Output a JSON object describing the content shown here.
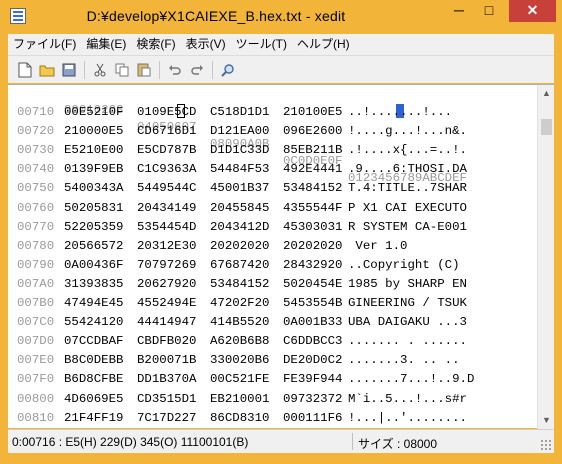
{
  "window": {
    "title": "D:¥develop¥X1CAIEXE_B.hex.txt - xedit",
    "minimize": "─",
    "maximize": "□",
    "close": "✕"
  },
  "menu": [
    "ファイル(F)",
    "編集(E)",
    "検索(F)",
    "表示(V)",
    "ツール(T)",
    "ヘルプ(H)"
  ],
  "toolbar": {
    "icons": [
      "new-file-icon",
      "open-folder-icon",
      "save-icon",
      "cut-icon",
      "copy-icon",
      "paste-icon",
      "undo-icon",
      "redo-icon",
      "search-icon"
    ]
  },
  "hex": {
    "header": {
      "groups": [
        "00010203",
        "04050607",
        "08090A0B",
        "0C0D0E0F"
      ],
      "ascii": "0123456789ABCDEF"
    },
    "rows": [
      {
        "offset": "00710",
        "groups": [
          "00E5210F",
          "0109E5CD",
          "C518D1D1",
          "210100E5"
        ],
        "ascii": "..!.......!..."
      },
      {
        "offset": "00720",
        "groups": [
          "210000E5",
          "CD6716D1",
          "D121EA00",
          "096E2600"
        ],
        "ascii": "!....g...!...n&."
      },
      {
        "offset": "00730",
        "groups": [
          "E5210E00",
          "E5CD787B",
          "D1D1C33D",
          "85EB211B"
        ],
        "ascii": ".!....x{...=..!."
      },
      {
        "offset": "00740",
        "groups": [
          "0139F9EB",
          "C1C9363A",
          "54484F53",
          "492E4441"
        ],
        "ascii": ".9....6:THOSI.DA"
      },
      {
        "offset": "00750",
        "groups": [
          "5400343A",
          "5449544C",
          "45001B37",
          "53484152"
        ],
        "ascii": "T.4:TITLE..7SHAR"
      },
      {
        "offset": "00760",
        "groups": [
          "50205831",
          "20434149",
          "20455845",
          "4355544F"
        ],
        "ascii": "P X1 CAI EXECUTO"
      },
      {
        "offset": "00770",
        "groups": [
          "52205359",
          "5354454D",
          "2043412D",
          "45303031"
        ],
        "ascii": "R SYSTEM CA-E001"
      },
      {
        "offset": "00780",
        "groups": [
          "20566572",
          "20312E30",
          "20202020",
          "20202020"
        ],
        "ascii": " Ver 1.0"
      },
      {
        "offset": "00790",
        "groups": [
          "0A00436F",
          "70797269",
          "67687420",
          "28432920"
        ],
        "ascii": "..Copyright (C)"
      },
      {
        "offset": "007A0",
        "groups": [
          "31393835",
          "20627920",
          "53484152",
          "5020454E"
        ],
        "ascii": "1985 by SHARP EN"
      },
      {
        "offset": "007B0",
        "groups": [
          "47494E45",
          "4552494E",
          "47202F20",
          "5453554B"
        ],
        "ascii": "GINEERING / TSUK"
      },
      {
        "offset": "007C0",
        "groups": [
          "55424120",
          "44414947",
          "414B5520",
          "0A001B33"
        ],
        "ascii": "UBA DAIGAKU ...3"
      },
      {
        "offset": "007D0",
        "groups": [
          "07CCDBAF",
          "CBDFB020",
          "A620B6B8",
          "C6DDBCC3"
        ],
        "ascii": "....... . ......"
      },
      {
        "offset": "007E0",
        "groups": [
          "B8C0DEBB",
          "B200071B",
          "330020B6",
          "DE20D0C2"
        ],
        "ascii": ".......3. .. .."
      },
      {
        "offset": "007F0",
        "groups": [
          "B6D8CFBE",
          "DD1B370A",
          "00C521FE",
          "FE39F944"
        ],
        "ascii": ".......7...!..9.D"
      },
      {
        "offset": "00800",
        "groups": [
          "4D6069E5",
          "CD3515D1",
          "EB210001",
          "09732372"
        ],
        "ascii": "M`i..5...!...s#r"
      },
      {
        "offset": "00810",
        "groups": [
          "21F4FF19",
          "7C17D227",
          "86CD8310",
          "000111F6"
        ],
        "ascii": "!...|..'........"
      }
    ]
  },
  "status": {
    "position": "0:00716 : E5(H) 229(D) 345(O) 11100101(B)",
    "size": "サイズ : 08000"
  }
}
